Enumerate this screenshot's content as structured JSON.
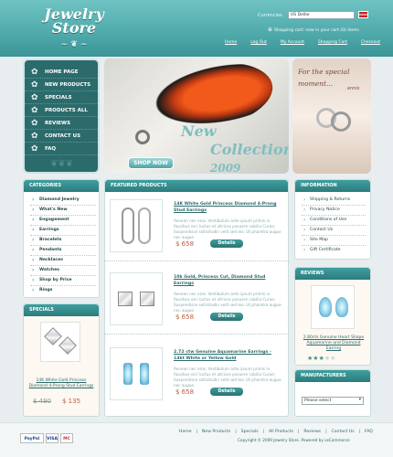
{
  "header": {
    "logo_line1": "Jewelry",
    "logo_line2": "Store",
    "currency_label": "Currencies",
    "currency_value": "US Dollar",
    "cart_text": "Shopping cart: now in your cart (0) items",
    "nav": [
      "Home",
      "Log Out",
      "My Account",
      "Shopping Cart",
      "Checkout"
    ]
  },
  "main_nav": [
    "HOME PAGE",
    "NEW PRODUCTS",
    "SPECIALS",
    "PRODUCTS ALL",
    "REVIEWS",
    "CONTACT US",
    "FAQ"
  ],
  "banner": {
    "title_line1": "New",
    "title_line2": "Collection",
    "year": "2009",
    "shop_button": "SHOP NOW"
  },
  "special_banner": {
    "line1": "For the special",
    "line2": "moment...",
    "logo": "ennis"
  },
  "categories": {
    "title": "CATEGORIES",
    "items": [
      "Diamond Jewelry",
      "What's New",
      "Engagement",
      "Earrings",
      "Bracelets",
      "Pendants",
      "Necklaces",
      "Watches",
      "Shop by Price",
      "Rings"
    ]
  },
  "specials": {
    "title": "SPECIALS",
    "item_name": "14K White Gold Princess Diamond 4-Prong Stud Earrings",
    "old_price": "$ 490",
    "new_price": "$ 135"
  },
  "featured": {
    "title": "FEATURED PRODUCTS",
    "products": [
      {
        "name": "14K White Gold Princess Diamond 4-Prong Stud Earrings",
        "desc": "Aenean nec eros. Vestibulum ante ipsum primis in faucibus orci luctus et ultrices posuere cubilia Curae; Suspendisse sollicitudin velit sed leo. Ut pharetra augue nec augue.",
        "price": "$ 658",
        "button": "Details"
      },
      {
        "name": "10k Gold, Princess Cut, Diamond Stud Earrings",
        "desc": "Aenean nec eros. Vestibulum ante ipsum primis in faucibus orci luctus et ultrices posuere cubilia Curae; Suspendisse sollicitudin velit sed leo. Ut pharetra augue nec augue.",
        "price": "$ 658",
        "button": "Details"
      },
      {
        "name": "2.72 ctw Genuine Aquamarine Earrings - 14kt White or Yellow Gold",
        "desc": "Aenean nec eros. Vestibulum ante ipsum primis in faucibus orci luctus et ultrices posuere cubilia Curae; Suspendisse sollicitudin velit sed leo. Ut pharetra augue nec augue.",
        "price": "$ 658",
        "button": "Details"
      }
    ]
  },
  "information": {
    "title": "INFORMATION",
    "items": [
      "Shipping & Returns",
      "Privacy Notice",
      "Conditions of Use",
      "Contact Us",
      "Site Map",
      "Gift Certificate"
    ]
  },
  "reviews": {
    "title": "REVIEWS",
    "text": "2.80cts Genuine Heart Shape Aquamarine and Diamond Earring",
    "rating": 3,
    "max_rating": 5
  },
  "manufacturers": {
    "title": "MANUFACTURERS",
    "select_value": "Please select"
  },
  "footer": {
    "links": [
      "Home",
      "New Products",
      "Specials",
      "All Products",
      "Reviews",
      "Contact Us",
      "FAQ"
    ],
    "copyright": "Copyright © 2009 Jewelry Store. Powered by osCommerce",
    "payments": [
      "PayPal",
      "VISA",
      "MC"
    ]
  },
  "colors": {
    "accent": "#3b9495",
    "price": "#c25b3a",
    "header": "#4aa5a6"
  }
}
